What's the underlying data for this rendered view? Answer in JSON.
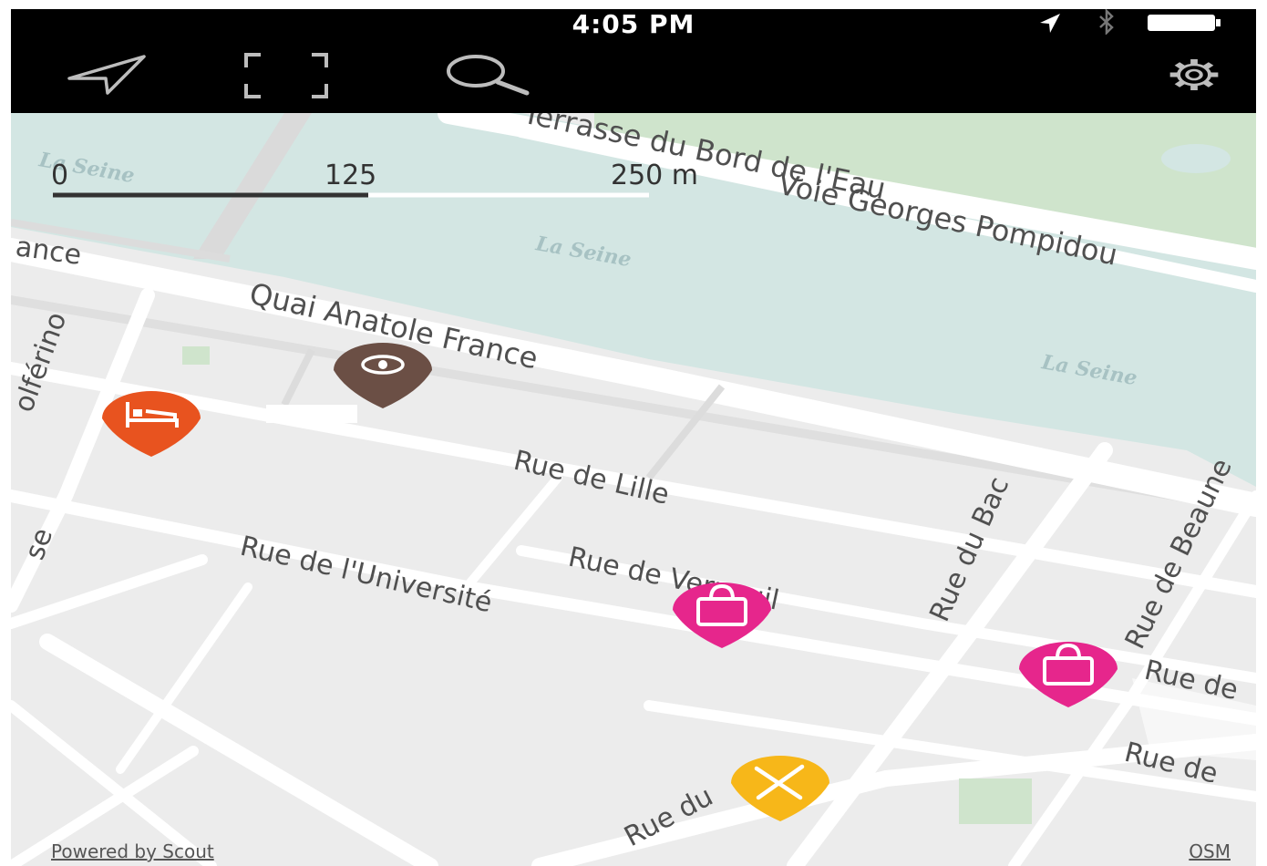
{
  "status_bar": {
    "time": "4:05 PM"
  },
  "toolbar": {
    "icons": [
      "location-arrow-icon",
      "fullscreen-icon",
      "search-icon",
      "gear-icon"
    ]
  },
  "scale_bar": {
    "labels": [
      "0",
      "125",
      "250 m"
    ]
  },
  "streets": {
    "terrasse": "Terrasse du Bord de l'Eau",
    "pompidou": "Voie Georges Pompidou",
    "quai": "Quai Anatole France",
    "lille": "Rue de Lille",
    "universite": "Rue de l'Université",
    "verneuil": "Rue de Verneuil",
    "bac": "Rue du Bac",
    "beaune": "Rue de Beaune",
    "right1": "Rue de",
    "right2": "Rue de",
    "bottom": "Rue du",
    "france_left": "ance",
    "solferino": "olférino",
    "left_se": "se"
  },
  "water_labels": [
    "La Seine",
    "La Seine",
    "La Seine"
  ],
  "pins": [
    {
      "category": "hotel",
      "color": "#e8531f",
      "icon": "bed-icon"
    },
    {
      "category": "sight",
      "color": "#6b4f45",
      "icon": "eye-icon"
    },
    {
      "category": "shopping",
      "color": "#e6268c",
      "icon": "bag-icon"
    },
    {
      "category": "shopping",
      "color": "#e6268c",
      "icon": "bag-icon"
    },
    {
      "category": "restaurant",
      "color": "#f7b719",
      "icon": "fork-knife-icon"
    }
  ],
  "colors": {
    "water": "#d3e6e3",
    "park": "#cfe4cc",
    "land": "#ececec",
    "road": "#ffffff"
  },
  "footer": {
    "powered_by": "Powered by Scout",
    "attribution": "OSM"
  }
}
